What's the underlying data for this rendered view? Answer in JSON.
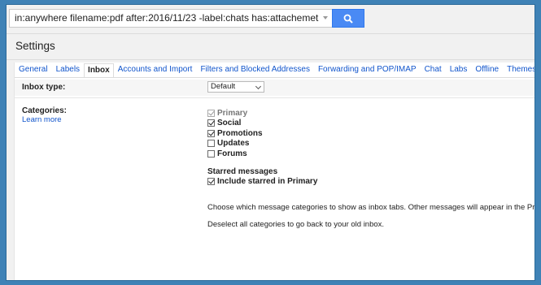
{
  "search": {
    "query": "in:anywhere filename:pdf after:2016/11/23 -label:chats has:attachemet"
  },
  "page_title": "Settings",
  "tabs": [
    {
      "label": "General"
    },
    {
      "label": "Labels"
    },
    {
      "label": "Inbox",
      "active": true
    },
    {
      "label": "Accounts and Import"
    },
    {
      "label": "Filters and Blocked Addresses"
    },
    {
      "label": "Forwarding and POP/IMAP"
    },
    {
      "label": "Chat"
    },
    {
      "label": "Labs"
    },
    {
      "label": "Offline"
    },
    {
      "label": "Themes"
    }
  ],
  "inbox_type": {
    "label": "Inbox type:",
    "selected": "Default"
  },
  "categories": {
    "label": "Categories:",
    "learn_more": "Learn more",
    "items": [
      {
        "label": "Primary",
        "checked": true,
        "disabled": true
      },
      {
        "label": "Social",
        "checked": true
      },
      {
        "label": "Promotions",
        "checked": true
      },
      {
        "label": "Updates",
        "checked": false
      },
      {
        "label": "Forums",
        "checked": false
      }
    ],
    "starred_title": "Starred messages",
    "starred_option": {
      "label": "Include starred in Primary",
      "checked": true
    },
    "description_1": "Choose which message categories to show as inbox tabs. Other messages will appear in the Primary tab.",
    "description_2": "Deselect all categories to go back to your old inbox."
  },
  "colors": {
    "accent_blue": "#4a8af4",
    "link_blue": "#1155cc",
    "frame_blue": "#3f82b6"
  }
}
